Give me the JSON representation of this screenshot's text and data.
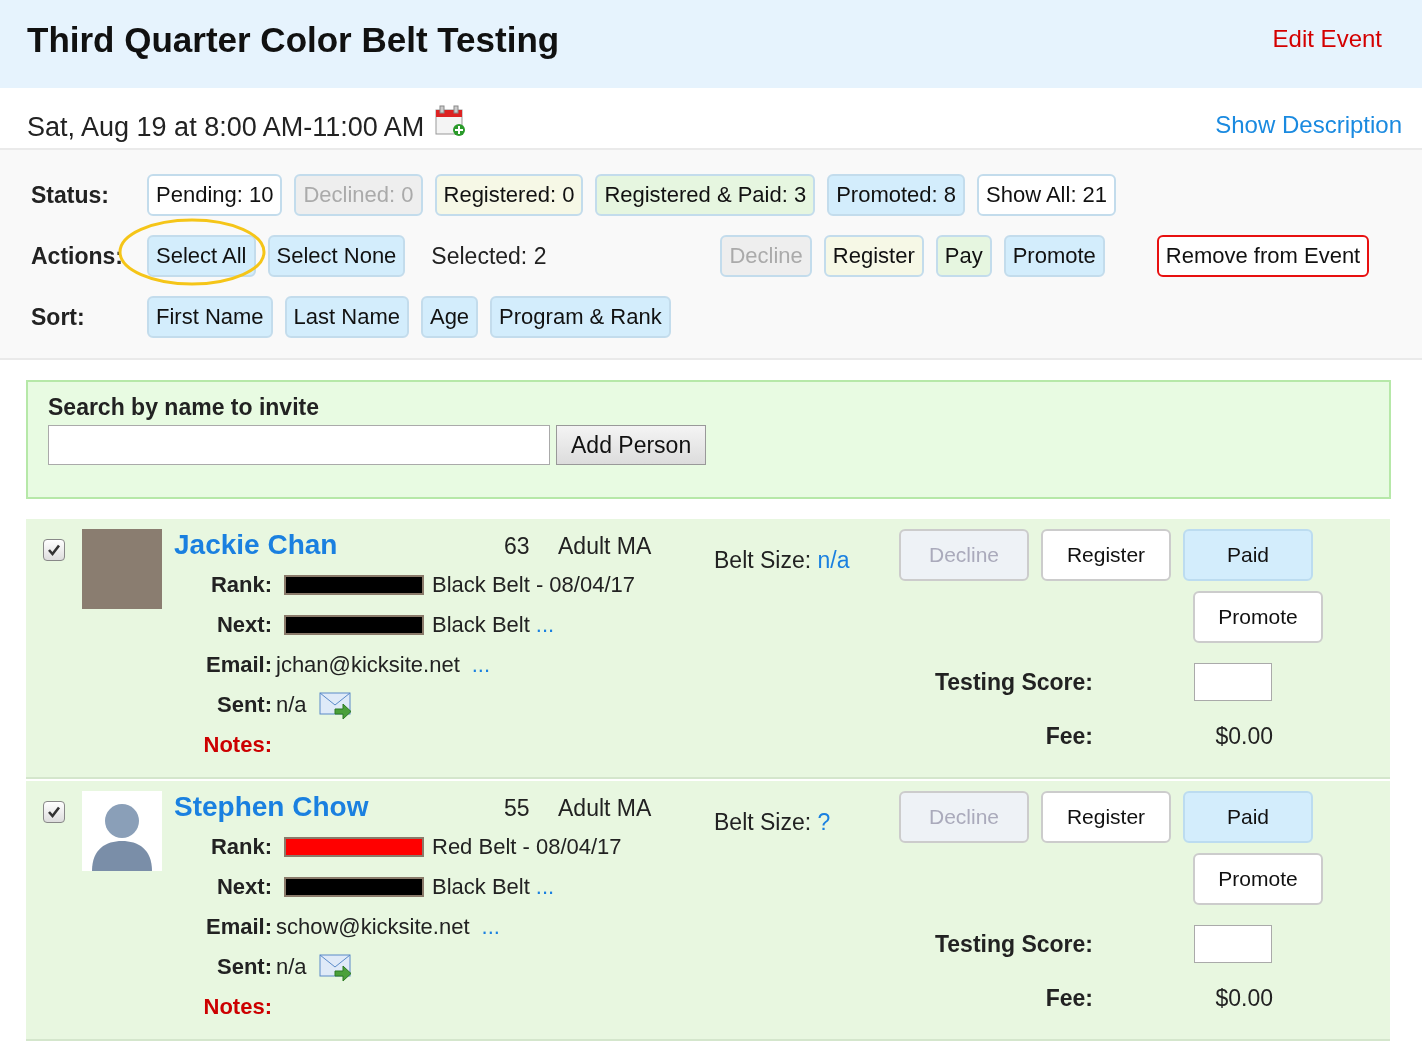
{
  "event": {
    "title": "Third Quarter Color Belt Testing",
    "edit_link": "Edit Event",
    "datetime": "Sat, Aug 19 at 8:00 AM-11:00 AM",
    "description_link": "Show Description"
  },
  "status": {
    "label": "Status:",
    "filters": [
      {
        "label": "Pending: 10",
        "color": "#ffffff",
        "disabled": false
      },
      {
        "label": "Declined: 0",
        "color": "#eeeeee",
        "disabled": true
      },
      {
        "label": "Registered: 0",
        "color": "#f6f8e6",
        "disabled": false
      },
      {
        "label": "Registered & Paid: 3",
        "color": "#e6f6e0",
        "disabled": false
      },
      {
        "label": "Promoted: 8",
        "color": "#d3edfc",
        "disabled": false
      },
      {
        "label": "Show All: 21",
        "color": "#ffffff",
        "disabled": false
      }
    ]
  },
  "actions": {
    "label": "Actions:",
    "select_all": "Select All",
    "select_none": "Select None",
    "selected_count": "Selected: 2",
    "buttons": [
      {
        "label": "Decline",
        "kind": "normal",
        "color": "#eeeeee",
        "disabled": true
      },
      {
        "label": "Register",
        "kind": "normal",
        "color": "#f6f8e6",
        "disabled": false
      },
      {
        "label": "Pay",
        "kind": "normal",
        "color": "#e6f6e0",
        "disabled": false
      },
      {
        "label": "Promote",
        "kind": "normal",
        "color": "#d3edfc",
        "disabled": false
      },
      {
        "label": "Remove from Event",
        "kind": "danger",
        "color": "#ffffff",
        "disabled": false
      }
    ]
  },
  "sort": {
    "label": "Sort:",
    "options": [
      "First Name",
      "Last Name",
      "Age",
      "Program & Rank"
    ]
  },
  "invite": {
    "title": "Search by name to invite",
    "button": "Add Person"
  },
  "people": [
    {
      "checked": true,
      "photo": true,
      "name": "Jackie Chan",
      "age": "63",
      "program": "Adult MA",
      "rank_label": "Rank:",
      "rank_belt": {
        "color": "#000000"
      },
      "rank": "Black Belt - 08/04/17",
      "next_label": "Next:",
      "next_belt": {
        "color": "#000000"
      },
      "next": "Black Belt",
      "next_more": "...",
      "email_label": "Email:",
      "email": "jchan@kicksite.net",
      "email_more": "...",
      "sent_label": "Sent:",
      "sent": "n/a",
      "notes_label": "Notes:",
      "belt_size_label": "Belt Size:",
      "belt_size": "n/a",
      "buttons": [
        {
          "label": "Decline",
          "disabled": true,
          "selected": false
        },
        {
          "label": "Register",
          "disabled": false,
          "selected": false
        },
        {
          "label": "Paid",
          "disabled": false,
          "selected": true
        },
        {
          "label": "Promote",
          "disabled": false,
          "selected": false
        }
      ],
      "score_label": "Testing Score:",
      "fee_label": "Fee:",
      "fee": "$0.00"
    },
    {
      "checked": true,
      "photo": false,
      "name": "Stephen Chow",
      "age": "55",
      "program": "Adult MA",
      "rank_label": "Rank:",
      "rank_belt": {
        "color": "#ff0000"
      },
      "rank": "Red Belt - 08/04/17",
      "next_label": "Next:",
      "next_belt": {
        "color": "#000000"
      },
      "next": "Black Belt",
      "next_more": "...",
      "email_label": "Email:",
      "email": "schow@kicksite.net",
      "email_more": "...",
      "sent_label": "Sent:",
      "sent": "n/a",
      "notes_label": "Notes:",
      "belt_size_label": "Belt Size:",
      "belt_size": "?",
      "buttons": [
        {
          "label": "Decline",
          "disabled": true,
          "selected": false
        },
        {
          "label": "Register",
          "disabled": false,
          "selected": false
        },
        {
          "label": "Paid",
          "disabled": false,
          "selected": true
        },
        {
          "label": "Promote",
          "disabled": false,
          "selected": false
        }
      ],
      "score_label": "Testing Score:",
      "fee_label": "Fee:",
      "fee": "$0.00"
    }
  ]
}
